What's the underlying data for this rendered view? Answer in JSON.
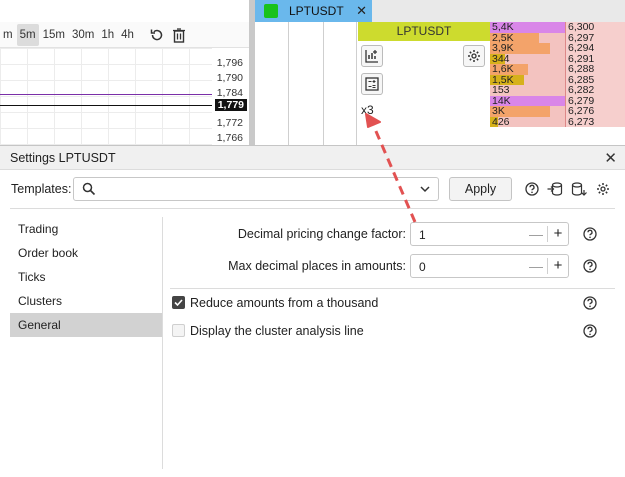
{
  "chart": {
    "timeframes": [
      "m",
      "5m",
      "15m",
      "30m",
      "1h",
      "4h"
    ],
    "active_timeframe": "5m",
    "ticks": [
      "1,796",
      "1,790",
      "1,784",
      "1,779",
      "1,772",
      "1,766"
    ],
    "current_price": "1,779",
    "icons": [
      "reset-icon",
      "trash-icon"
    ]
  },
  "orderbook": {
    "tab_label": "LPTUSDT",
    "tab_color": "#19c21a",
    "header": "LPTUSDT",
    "multiplier": "x3",
    "rows": [
      {
        "vol": "5,4K",
        "price": "6,300",
        "color": "#d986e8",
        "fill": 1.0
      },
      {
        "vol": "2,5K",
        "price": "6,297",
        "color": "#f3a36a",
        "fill": 0.65
      },
      {
        "vol": "3,9K",
        "price": "6,294",
        "color": "#f3a36a",
        "fill": 0.8
      },
      {
        "vol": "344",
        "price": "6,291",
        "color": "#d6b11b",
        "fill": 0.2
      },
      {
        "vol": "1,6K",
        "price": "6,288",
        "color": "#f3a36a",
        "fill": 0.5
      },
      {
        "vol": "1,5K",
        "price": "6,285",
        "color": "#d6b11b",
        "fill": 0.45
      },
      {
        "vol": "153",
        "price": "6,282",
        "color": "#f3c3c0",
        "fill": 0.0
      },
      {
        "vol": "14K",
        "price": "6,279",
        "color": "#d986e8",
        "fill": 1.0
      },
      {
        "vol": "3K",
        "price": "6,276",
        "color": "#f3a36a",
        "fill": 0.8
      },
      {
        "vol": "426",
        "price": "6,273",
        "color": "#d6b11b",
        "fill": 0.1
      }
    ]
  },
  "dialog": {
    "title": "Settings LPTUSDT",
    "templates_label": "Templates:",
    "templates_value": "",
    "apply_label": "Apply",
    "nav": [
      {
        "label": "Trading",
        "active": false
      },
      {
        "label": "Order book",
        "active": false
      },
      {
        "label": "Ticks",
        "active": false
      },
      {
        "label": "Clusters",
        "active": false
      },
      {
        "label": "General",
        "active": true
      }
    ],
    "fields": [
      {
        "label": "Decimal pricing change factor:",
        "value": "1"
      },
      {
        "label": "Max decimal places in amounts:",
        "value": "0"
      }
    ],
    "checks": [
      {
        "label": "Reduce amounts from a thousand",
        "checked": true
      },
      {
        "label": "Display the cluster analysis line",
        "checked": false
      }
    ]
  }
}
